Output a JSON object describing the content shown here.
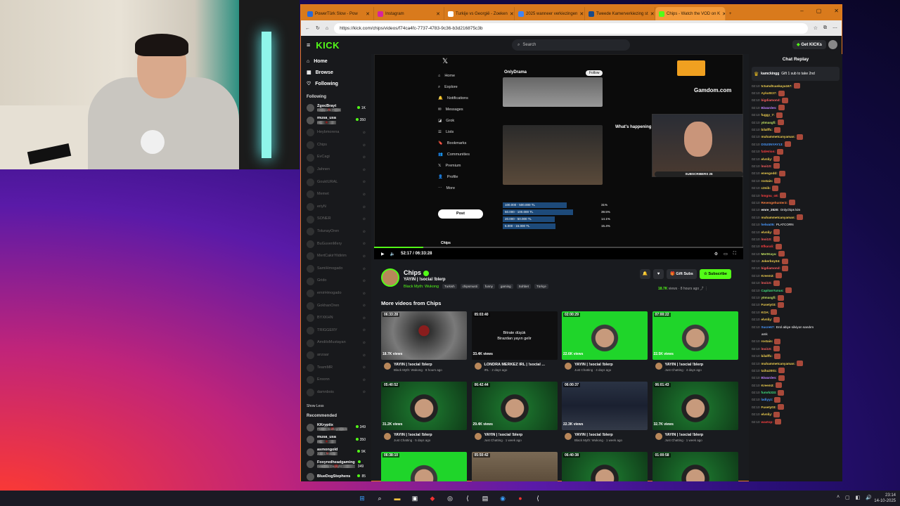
{
  "browser": {
    "tabs": [
      {
        "label": "PowerTürk Slow - Pow",
        "color": "#2a6ad8"
      },
      {
        "label": "Instagram",
        "color": "#d6249f"
      },
      {
        "label": "Turkije vs Georgië - Zoeken",
        "color": "#ffffff"
      },
      {
        "label": "2025 wanneer verkiezingen",
        "color": "#4285f4"
      },
      {
        "label": "Tweede Kamerverkiezing st",
        "color": "#1a4a8a"
      },
      {
        "label": "Chips - Watch the VOD on K",
        "color": "#53fc18"
      }
    ],
    "url": "https://kick.com/chips/videos/f74ca4fc-7737-4783-9c36-b3d216875c3b",
    "window_controls": [
      "–",
      "▢",
      "✕"
    ],
    "new_tab": "+"
  },
  "kick": {
    "logo": "KICK",
    "search_placeholder": "Search",
    "get_kicks": "Get KICKs"
  },
  "sidebar": {
    "nav": [
      {
        "label": "Home",
        "icon": "home-icon"
      },
      {
        "label": "Browse",
        "icon": "browse-icon"
      },
      {
        "label": "Following",
        "icon": "heart-icon"
      }
    ],
    "following_title": "Following",
    "following": [
      {
        "name": "ZgocBrayt",
        "game": "EA Sports FC 26",
        "viewers": "1K",
        "live": true
      },
      {
        "name": "musa_usa",
        "game": "IRL",
        "viewers": "350",
        "live": true
      },
      {
        "name": "Heybmorena",
        "game": "",
        "viewers": "",
        "live": false
      },
      {
        "name": "Chips",
        "game": "",
        "viewers": "",
        "live": false
      },
      {
        "name": "EvCagi",
        "game": "",
        "viewers": "",
        "live": false
      },
      {
        "name": "Jahnen",
        "game": "",
        "viewers": "",
        "live": false
      },
      {
        "name": "GoukIURAL",
        "game": "",
        "viewers": "",
        "live": false
      },
      {
        "name": "Memet",
        "game": "",
        "viewers": "",
        "live": false
      },
      {
        "name": "eriyN",
        "game": "",
        "viewers": "",
        "live": false
      },
      {
        "name": "SONER",
        "game": "",
        "viewers": "",
        "live": false
      },
      {
        "name": "TolunayOren",
        "game": "",
        "viewers": "",
        "live": false
      },
      {
        "name": "BuGuvenMery",
        "game": "",
        "viewers": "",
        "live": false
      },
      {
        "name": "MertCakirYildirim",
        "game": "",
        "viewers": "",
        "live": false
      },
      {
        "name": "SamiHmogado",
        "game": "",
        "viewers": "",
        "live": false
      },
      {
        "name": "Grido",
        "game": "",
        "viewers": "",
        "live": false
      },
      {
        "name": "emirHmogado",
        "game": "",
        "viewers": "",
        "live": false
      },
      {
        "name": "GokhanOren",
        "game": "",
        "viewers": "",
        "live": false
      },
      {
        "name": "BYXKHN",
        "game": "",
        "viewers": "",
        "live": false
      },
      {
        "name": "TRIGGERY",
        "game": "",
        "viewers": "",
        "live": false
      },
      {
        "name": "AmdiloMustayan",
        "game": "",
        "viewers": "",
        "live": false
      },
      {
        "name": "anzaar",
        "game": "",
        "viewers": "",
        "live": false
      },
      {
        "name": "TeamMR",
        "game": "",
        "viewers": "",
        "live": false
      },
      {
        "name": "Eroonn",
        "game": "",
        "viewers": "",
        "live": false
      },
      {
        "name": "damnbois",
        "game": "",
        "viewers": "",
        "live": false
      }
    ],
    "show_less": "Show Less",
    "recommended_title": "Recommended",
    "recommended": [
      {
        "name": "KKryptix",
        "game": "PUBG: Battlegrounds",
        "viewers": "349"
      },
      {
        "name": "musa_usa",
        "game": "IRL",
        "viewers": "350"
      },
      {
        "name": "asmongold",
        "game": "Just Chatting",
        "viewers": "9K"
      },
      {
        "name": "Foxyredheadgaming",
        "game": "Dead By Daylight",
        "viewers": "349"
      },
      {
        "name": "BlueDogStephens",
        "game": "",
        "viewers": "85"
      }
    ]
  },
  "player": {
    "time": "52:17 / 06:33:28",
    "feed": {
      "menu": [
        "Home",
        "Explore",
        "Notifications",
        "Messages",
        "Grok",
        "Lists",
        "Bookmarks",
        "Communities",
        "Premium",
        "Profile",
        "More"
      ],
      "post_label": "Post",
      "account_name": "OnlyDrama",
      "follow_label": "Follow",
      "whats_happening": "What's happening",
      "poll": [
        {
          "label": "100.000 - 500.000 TL",
          "pct": "31%"
        },
        {
          "label": "50.000 - 100.000 TL",
          "pct": "39.5%"
        },
        {
          "label": "20.000 - 50.000 TL",
          "pct": "14.1%"
        },
        {
          "label": "5.000 - 15.000 TL",
          "pct": "15.4%"
        }
      ],
      "user": "Chips"
    },
    "gamdom": "Gamdom.com",
    "subscribers": "SUBSCRIBERS",
    "subs_count": "26"
  },
  "channel": {
    "name": "Chips",
    "title": "YAYIN | !social !blerp",
    "category": "Black Myth: Wukong",
    "tags": [
      "Turkish",
      "chipsmusti",
      "funny",
      "gaming",
      "Sohbet",
      "Türkçe"
    ],
    "gift_label": "Gift Subs",
    "subscribe_label": "Subscribe",
    "views": "18.7K",
    "views_word": "views",
    "ago": "8 hours ago"
  },
  "more_videos_title": "More videos from Chips",
  "videos": [
    {
      "dur": "06:33:28",
      "views": "18.7K views",
      "title": "YAYIN | !social !blerp",
      "sub": "Black Myth: Wukong · 8 hours ago",
      "style": "gm"
    },
    {
      "dur": "05:03:40",
      "views": "33.4K views",
      "title": "LONDRA MERKEZ IRL | !social ...",
      "sub": "IRL · 2 days ago",
      "style": "dk"
    },
    {
      "dur": "02:00:29",
      "views": "22.6K views",
      "title": "YAYIN | !social !blerp",
      "sub": "Just Chatting · 4 days ago",
      "style": "g"
    },
    {
      "dur": "07:00:22",
      "views": "22.5K views",
      "title": "YAYIN | !social !blerp",
      "sub": "Just Chatting · 4 days ago",
      "style": "g"
    },
    {
      "dur": "05:40:52",
      "views": "31.2K views",
      "title": "YAYIN | !social !blerp",
      "sub": "Just Chatting · 5 days ago",
      "style": "g2"
    },
    {
      "dur": "06:42:44",
      "views": "29.4K views",
      "title": "YAYIN | !social !blerp",
      "sub": "Just Chatting · 1 week ago",
      "style": "g2"
    },
    {
      "dur": "06:00:37",
      "views": "22.3K views",
      "title": "YAYIN | !social !blerp",
      "sub": "Black Myth: Wukong · 1 week ago",
      "style": "ds"
    },
    {
      "dur": "06:01:43",
      "views": "32.7K views",
      "title": "YAYIN | !social !blerp",
      "sub": "Just Chatting · 1 week ago",
      "style": "g2"
    },
    {
      "dur": "06:38:10",
      "views": "",
      "title": "",
      "sub": "",
      "style": "g"
    },
    {
      "dur": "05:50:42",
      "views": "",
      "title": "",
      "sub": "",
      "style": "st"
    },
    {
      "dur": "06:40:38",
      "views": "",
      "title": "",
      "sub": "",
      "style": "g2"
    },
    {
      "dur": "01:00:58",
      "views": "",
      "title": "",
      "sub": "",
      "style": "g2"
    }
  ],
  "video_text_labels": {
    "dark_thumb_line1": "Bitrate düşük",
    "dark_thumb_line2": "Birazdan yayın gelir"
  },
  "chat": {
    "title": "Chat Replay",
    "pinned_user": "kamckingg",
    "pinned_text": "Gift 1 sub to take 2nd",
    "messages": [
      {
        "t": "02:10",
        "u": "tctumdtcankaya167:",
        "c": "#f0d050",
        "m": ""
      },
      {
        "t": "02:10",
        "u": "AykutE37:",
        "c": "#e8c040",
        "m": ""
      },
      {
        "t": "02:10",
        "u": "bigdiamond:",
        "c": "#ff6060",
        "m": ""
      },
      {
        "t": "02:10",
        "u": "Biwarden:",
        "c": "#c080ff",
        "m": ""
      },
      {
        "t": "02:10",
        "u": "fuggy_7:",
        "c": "#f0d050",
        "m": ""
      },
      {
        "t": "02:10",
        "u": "y0masgfi:",
        "c": "#c0e060",
        "m": ""
      },
      {
        "t": "02:10",
        "u": "bilalffc:",
        "c": "#f0d050",
        "m": ""
      },
      {
        "t": "02:10",
        "u": "muhammetcanyaman:",
        "c": "#f0d050",
        "m": ""
      },
      {
        "t": "02:10",
        "u": "DSUSNYAY13:",
        "c": "#4a9aff",
        "m": ""
      },
      {
        "t": "02:10",
        "u": "fatiHrion:",
        "c": "#ff4040",
        "m": ""
      },
      {
        "t": "02:10",
        "u": "elvnliy:",
        "c": "#f0d050",
        "m": ""
      },
      {
        "t": "02:10",
        "u": "lnoi1S:",
        "c": "#ff6060",
        "m": ""
      },
      {
        "t": "02:10",
        "u": "enesgodd:",
        "c": "#f0d050",
        "m": ""
      },
      {
        "t": "02:10",
        "u": "rostain:",
        "c": "#f0d050",
        "m": ""
      },
      {
        "t": "02:10",
        "u": "c3nib:",
        "c": "#f0d050",
        "m": ""
      },
      {
        "t": "02:10",
        "u": "hmgnu_o8:",
        "c": "#ff4040",
        "m": ""
      },
      {
        "t": "02:10",
        "u": "Revengehunter3:",
        "c": "#ff8040",
        "m": ""
      },
      {
        "t": "02:10",
        "u": "emre_2020:",
        "c": "#ffffff",
        "m": "Onlychips kim"
      },
      {
        "t": "02:10",
        "u": "muhammetcanyaman:",
        "c": "#f0d050",
        "m": ""
      },
      {
        "t": "02:10",
        "u": "helwa05:",
        "c": "#4a9aff",
        "m": "PLATCORN"
      },
      {
        "t": "02:10",
        "u": "elvnliy:",
        "c": "#f0d050",
        "m": ""
      },
      {
        "t": "02:10",
        "u": "lnoi1S:",
        "c": "#ff6060",
        "m": ""
      },
      {
        "t": "02:10",
        "u": "Efkarali:",
        "c": "#ff4040",
        "m": ""
      },
      {
        "t": "02:10",
        "u": "MertKaya:",
        "c": "#c0e060",
        "m": ""
      },
      {
        "t": "02:10",
        "u": "Jokerboy34:",
        "c": "#f0d050",
        "m": ""
      },
      {
        "t": "02:10",
        "u": "bigdiamond:",
        "c": "#ff6060",
        "m": ""
      },
      {
        "t": "02:10",
        "u": "Kreem3:",
        "c": "#f0d050",
        "m": ""
      },
      {
        "t": "02:10",
        "u": "lnoi1S:",
        "c": "#ff6060",
        "m": ""
      },
      {
        "t": "02:10",
        "u": "CapitanYunus:",
        "c": "#40e080",
        "m": ""
      },
      {
        "t": "02:10",
        "u": "y0masgfi:",
        "c": "#c0e060",
        "m": ""
      },
      {
        "t": "02:10",
        "u": "Fusety03:",
        "c": "#f0d050",
        "m": ""
      },
      {
        "t": "02:10",
        "u": "KOA:",
        "c": "#f0d050",
        "m": ""
      },
      {
        "t": "02:10",
        "u": "elvnliy:",
        "c": "#f0d050",
        "m": ""
      },
      {
        "t": "02:10",
        "u": "Sucre67:",
        "c": "#4a9aff",
        "m": "Erol abiye silviyon sandım"
      },
      {
        "t": "",
        "u": "",
        "c": "#ffffff",
        "m": "amk"
      },
      {
        "t": "02:10",
        "u": "rostain:",
        "c": "#f0d050",
        "m": ""
      },
      {
        "t": "02:10",
        "u": "lnoi1S:",
        "c": "#ff6060",
        "m": ""
      },
      {
        "t": "02:10",
        "u": "bilalffc:",
        "c": "#f0d050",
        "m": ""
      },
      {
        "t": "02:10",
        "u": "muhammetcanyaman:",
        "c": "#f0d050",
        "m": ""
      },
      {
        "t": "02:10",
        "u": "taiha2001:",
        "c": "#f0d050",
        "m": ""
      },
      {
        "t": "02:10",
        "u": "Biwarden:",
        "c": "#c080ff",
        "m": ""
      },
      {
        "t": "02:10",
        "u": "Kreem3:",
        "c": "#f0d050",
        "m": ""
      },
      {
        "t": "02:10",
        "u": "fumrk333:",
        "c": "#40e080",
        "m": ""
      },
      {
        "t": "02:10",
        "u": "ladiyyz:",
        "c": "#4a9aff",
        "m": ""
      },
      {
        "t": "02:10",
        "u": "Fusety03:",
        "c": "#f0d050",
        "m": ""
      },
      {
        "t": "02:10",
        "u": "elvnliy:",
        "c": "#f0d050",
        "m": ""
      },
      {
        "t": "02:10",
        "u": "wastop:",
        "c": "#ff4040",
        "m": ""
      }
    ]
  },
  "taskbar": {
    "time": "23:14",
    "date": "14-10-2025"
  }
}
